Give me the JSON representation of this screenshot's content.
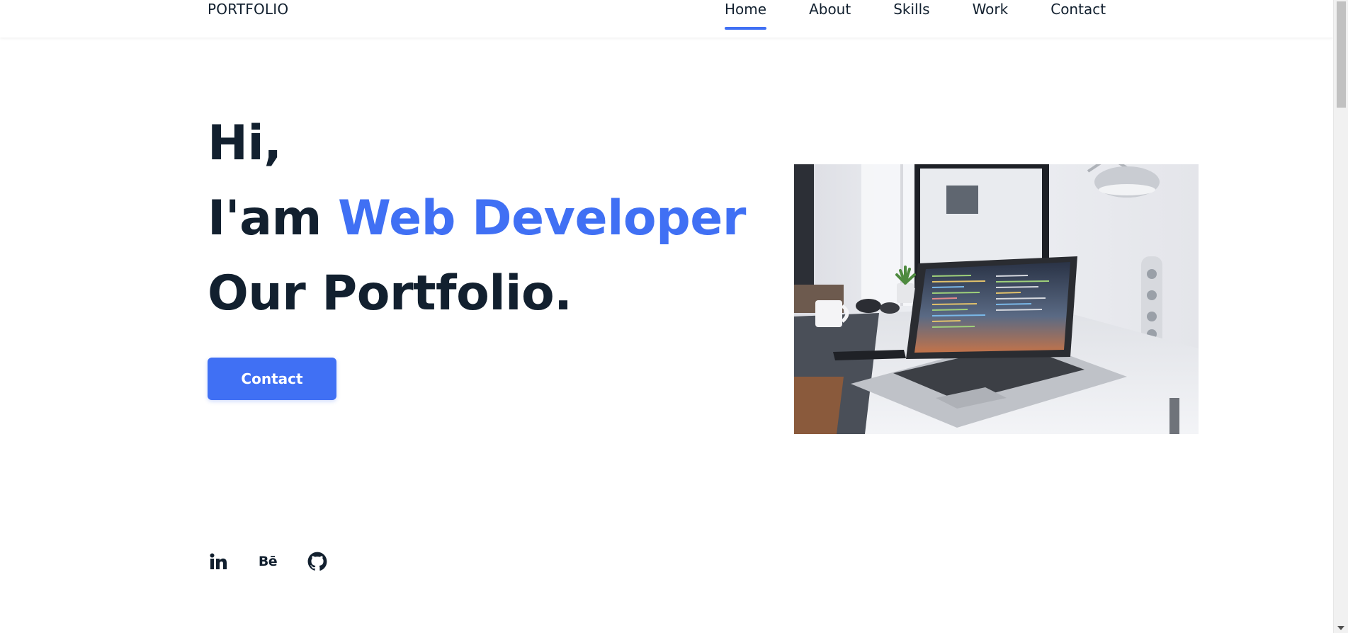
{
  "header": {
    "logo": "PORTFOLIO",
    "nav": [
      {
        "label": "Home",
        "active": true
      },
      {
        "label": "About",
        "active": false
      },
      {
        "label": "Skills",
        "active": false
      },
      {
        "label": "Work",
        "active": false
      },
      {
        "label": "Contact",
        "active": false
      }
    ]
  },
  "hero": {
    "line1": "Hi,",
    "line2_prefix": "I'am ",
    "line2_accent": "Web Developer",
    "line3": "Our Portfolio.",
    "button_label": "Contact"
  },
  "social": {
    "icons": [
      "linkedin-icon",
      "behance-icon",
      "github-icon"
    ],
    "behance_glyph": "Bē"
  },
  "colors": {
    "accent": "#4070f4",
    "text": "#12202f",
    "background": "#ffffff"
  }
}
